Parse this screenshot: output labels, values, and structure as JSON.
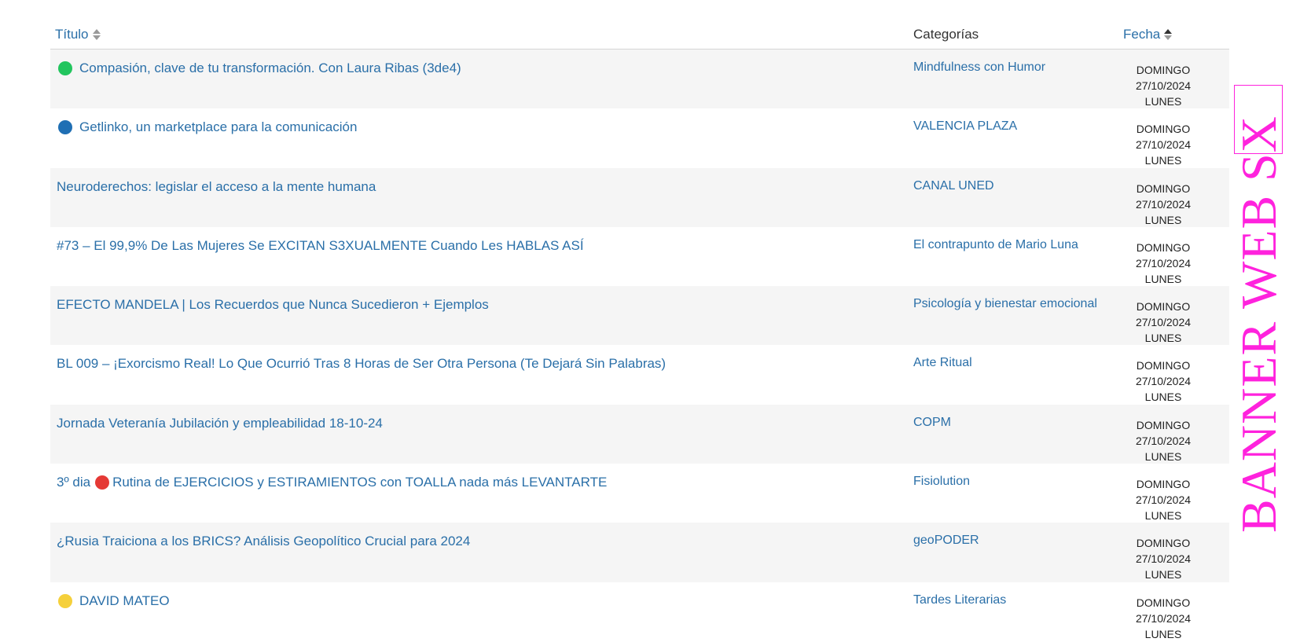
{
  "table": {
    "headers": {
      "title": "Título",
      "categories": "Categorías",
      "date": "Fecha"
    },
    "rows": [
      {
        "dot_color": "#22c55e",
        "title": "Compasión, clave de tu transformación. Con Laura Ribas (3de4)",
        "category": "Mindfulness con Humor",
        "day": "DOMINGO",
        "date": "27/10/2024",
        "day2": "LUNES"
      },
      {
        "dot_color": "#1f6fb4",
        "title": "Getlinko, un marketplace para la comunicación",
        "category": "VALENCIA PLAZA",
        "day": "DOMINGO",
        "date": "27/10/2024",
        "day2": "LUNES"
      },
      {
        "title": "Neuroderechos: legislar el acceso a la mente humana",
        "category": "CANAL UNED",
        "day": "DOMINGO",
        "date": "27/10/2024",
        "day2": "LUNES"
      },
      {
        "title": "#73 – El 99,9% De Las Mujeres Se EXCITAN S3XUALMENTE Cuando Les HABLAS ASÍ",
        "category": "El contrapunto de Mario Luna",
        "day": "DOMINGO",
        "date": "27/10/2024",
        "day2": "LUNES"
      },
      {
        "title": "EFECTO MANDELA | Los Recuerdos que Nunca Sucedieron + Ejemplos",
        "category": "Psicología y bienestar emocional",
        "day": "DOMINGO",
        "date": "27/10/2024",
        "day2": "LUNES"
      },
      {
        "title": "BL 009 – ¡Exorcismo Real! Lo Que Ocurrió Tras 8 Horas de Ser Otra Persona (Te Dejará Sin Palabras)",
        "category": "Arte Ritual",
        "day": "DOMINGO",
        "date": "27/10/2024",
        "day2": "LUNES"
      },
      {
        "title": "Jornada Veteranía Jubilación y empleabilidad 18-10-24",
        "category": "COPM",
        "day": "DOMINGO",
        "date": "27/10/2024",
        "day2": "LUNES"
      },
      {
        "title_prefix": "3º dia",
        "inline_dot_color": "#e53935",
        "title": "Rutina de EJERCICIOS y ESTIRAMIENTOS con TOALLA nada más LEVANTARTE",
        "category": "Fisiolution",
        "day": "DOMINGO",
        "date": "27/10/2024",
        "day2": "LUNES"
      },
      {
        "title": "¿Rusia Traiciona a los BRICS? Análisis Geopolítico Crucial para 2024",
        "category": "geoPODER",
        "day": "DOMINGO",
        "date": "27/10/2024",
        "day2": "LUNES"
      },
      {
        "dot_color": "#f5d03b",
        "title": "DAVID MATEO",
        "category": "Tardes Literarias",
        "day": "DOMINGO",
        "date": "27/10/2024",
        "day2": "LUNES"
      }
    ]
  },
  "banner": {
    "text": "BANNER WEB SX",
    "color": "#ff22dd"
  },
  "colors": {
    "link": "#2a6fa8",
    "row_alt": "#f5f5f5"
  }
}
